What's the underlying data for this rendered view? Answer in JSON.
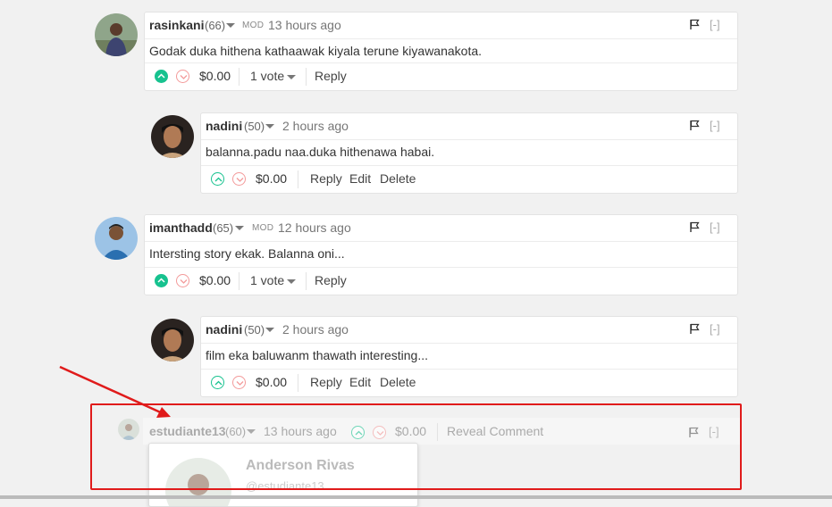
{
  "comments": [
    {
      "username": "rasinkani",
      "rep": "(66)",
      "mod": "MOD",
      "time": "13 hours ago",
      "text": "Godak duka hithena kathaawak kiyala terune kiyawanakota.",
      "amount": "$0.00",
      "votes": "1 vote",
      "reply": "Reply",
      "collapse": "[-]"
    },
    {
      "username": "nadini",
      "rep": "(50)",
      "time": "2 hours ago",
      "text": "balanna.padu naa.duka hithenawa habai.",
      "amount": "$0.00",
      "reply": "Reply",
      "edit": "Edit",
      "delete": "Delete",
      "collapse": "[-]"
    },
    {
      "username": "imanthadd",
      "rep": "(65)",
      "mod": "MOD",
      "time": "12 hours ago",
      "text": "Intersting story ekak. Balanna oni...",
      "amount": "$0.00",
      "votes": "1 vote",
      "reply": "Reply",
      "collapse": "[-]"
    },
    {
      "username": "nadini",
      "rep": "(50)",
      "time": "2 hours ago",
      "text": "film eka baluwanm thawath interesting...",
      "amount": "$0.00",
      "reply": "Reply",
      "edit": "Edit",
      "delete": "Delete",
      "collapse": "[-]"
    }
  ],
  "hidden": {
    "username": "estudiante13",
    "rep": "(60)",
    "time": "13 hours ago",
    "amount": "$0.00",
    "reveal": "Reveal Comment",
    "collapse": "[-]"
  },
  "popup": {
    "name": "Anderson Rivas",
    "handle": "@estudiante13"
  },
  "colors": {
    "upvote": "#17c28f",
    "downvote": "#f39a9a",
    "highlight": "#e01b1b"
  }
}
